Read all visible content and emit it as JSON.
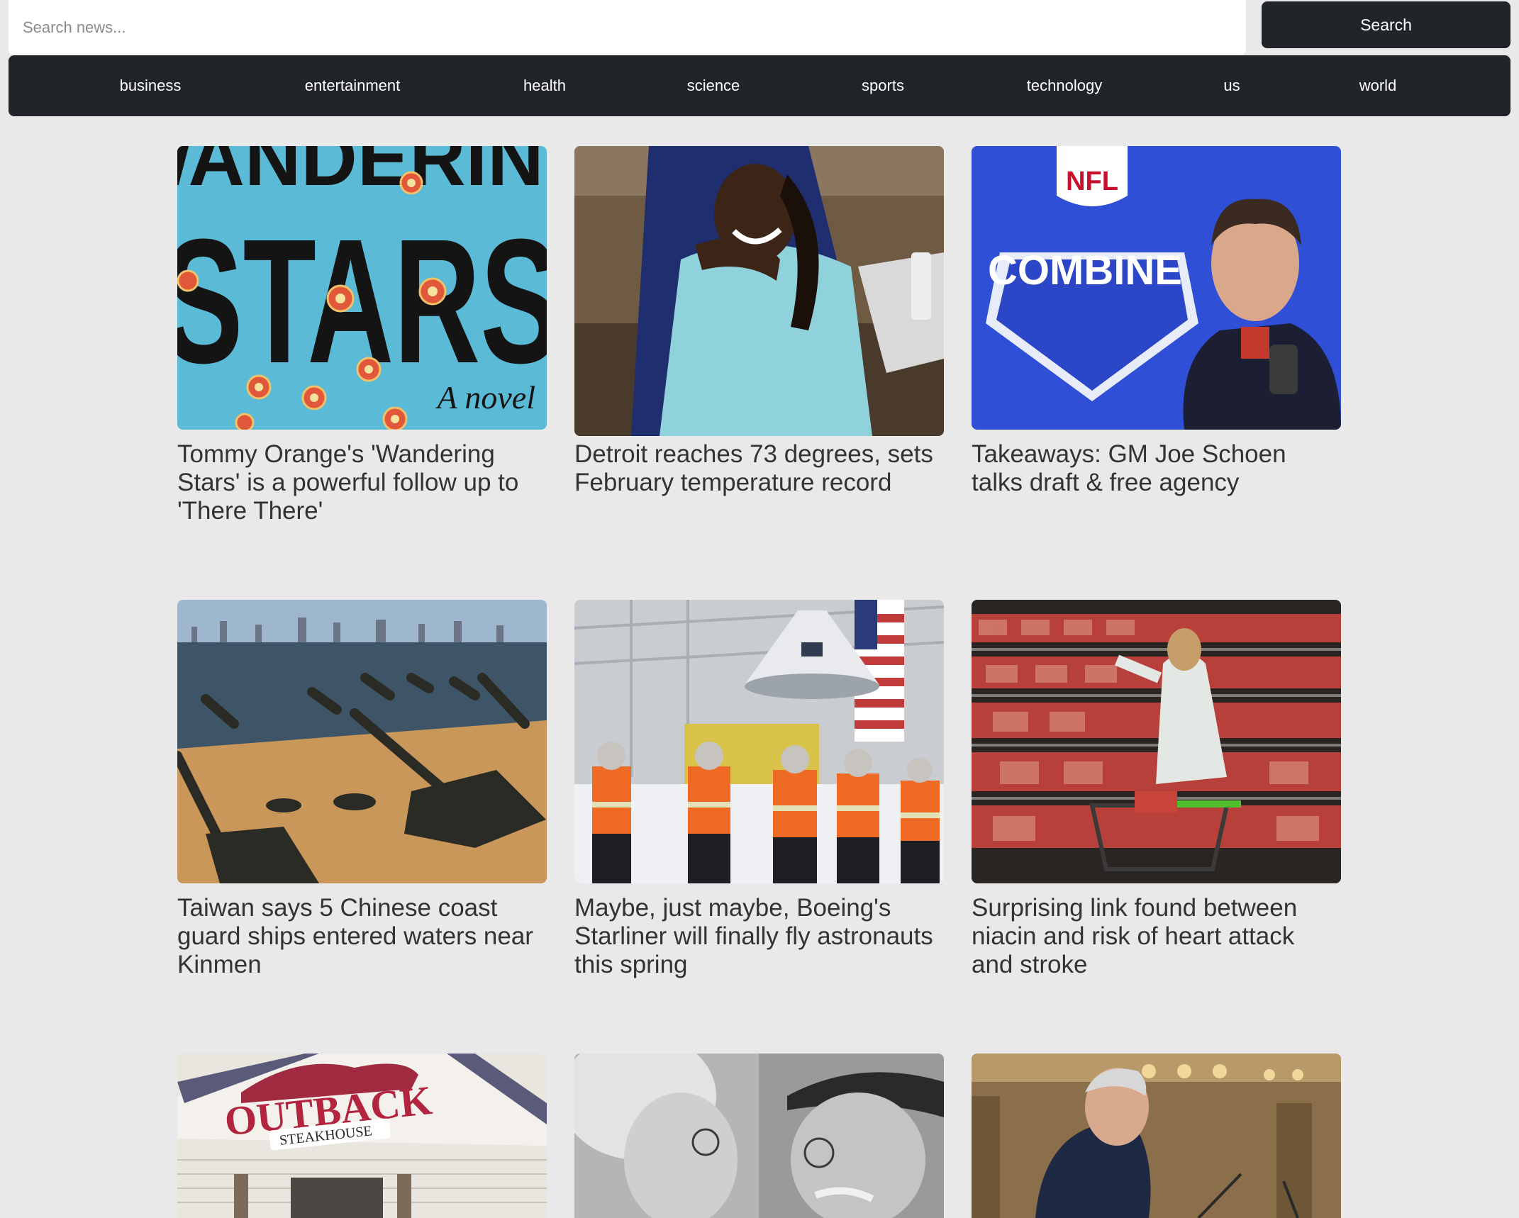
{
  "search": {
    "placeholder": "Search news...",
    "button_label": "Search"
  },
  "categories": [
    "business",
    "entertainment",
    "health",
    "science",
    "sports",
    "technology",
    "us",
    "world"
  ],
  "articles": [
    {
      "title": "Tommy Orange's 'Wandering Stars' is a powerful follow up to 'There There'",
      "image": "book-cover-image",
      "image_text": [
        "WANDERING",
        "STARS",
        "A novel"
      ]
    },
    {
      "title": "Detroit reaches 73 degrees, sets February temperature record",
      "image": "people-outdoors-photo"
    },
    {
      "title": "Takeaways: GM Joe Schoen talks draft & free agency",
      "image": "press-conference-photo",
      "image_text": [
        "NFL",
        "COMBINE"
      ]
    },
    {
      "title": "Taiwan says 5 Chinese coast guard ships entered waters near Kinmen",
      "image": "beach-barricades-photo"
    },
    {
      "title": "Maybe, just maybe, Boeing's Starliner will finally fly astronauts this spring",
      "image": "spacecraft-hangar-photo"
    },
    {
      "title": "Surprising link found between niacin and risk of heart attack and stroke",
      "image": "grocery-meat-aisle-photo"
    },
    {
      "title": "",
      "image": "restaurant-sign-photo",
      "image_text": [
        "OUTBACK",
        "STEAKHOUSE"
      ]
    },
    {
      "title": "",
      "image": "elderly-couple-photo"
    },
    {
      "title": "",
      "image": "official-at-podium-photo"
    }
  ],
  "colors": {
    "page_background": "#e9e9e9",
    "nav_background": "#212529",
    "title_text": "#333333"
  }
}
